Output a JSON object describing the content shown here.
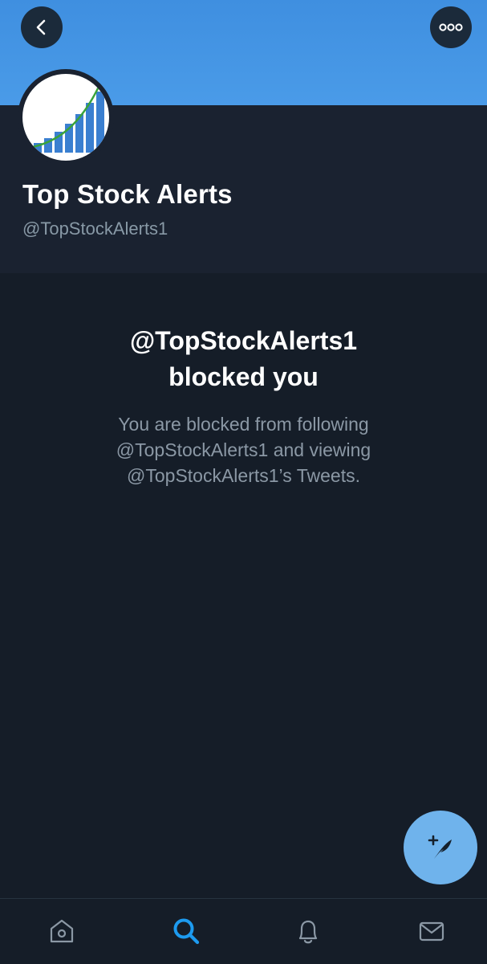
{
  "header": {
    "back_icon": "chevron-left-icon",
    "more_icon": "ellipsis-icon"
  },
  "profile": {
    "name": "Top Stock Alerts",
    "handle": "@TopStockAlerts1"
  },
  "blocked": {
    "title_line1": "@TopStockAlerts1",
    "title_line2": "blocked you",
    "body_line1": "You are blocked from following",
    "body_line2": "@TopStockAlerts1 and viewing",
    "body_line3": "@TopStockAlerts1’s Tweets."
  },
  "fab": {
    "icon": "compose-tweet-icon"
  },
  "nav": {
    "items": [
      {
        "icon": "home-icon",
        "active": false
      },
      {
        "icon": "search-icon",
        "active": true
      },
      {
        "icon": "bell-icon",
        "active": false
      },
      {
        "icon": "mail-icon",
        "active": false
      }
    ]
  },
  "colors": {
    "banner": "#4a9be8",
    "accent": "#1d9bf0",
    "background": "#151d28",
    "muted_text": "#8b98a5"
  }
}
